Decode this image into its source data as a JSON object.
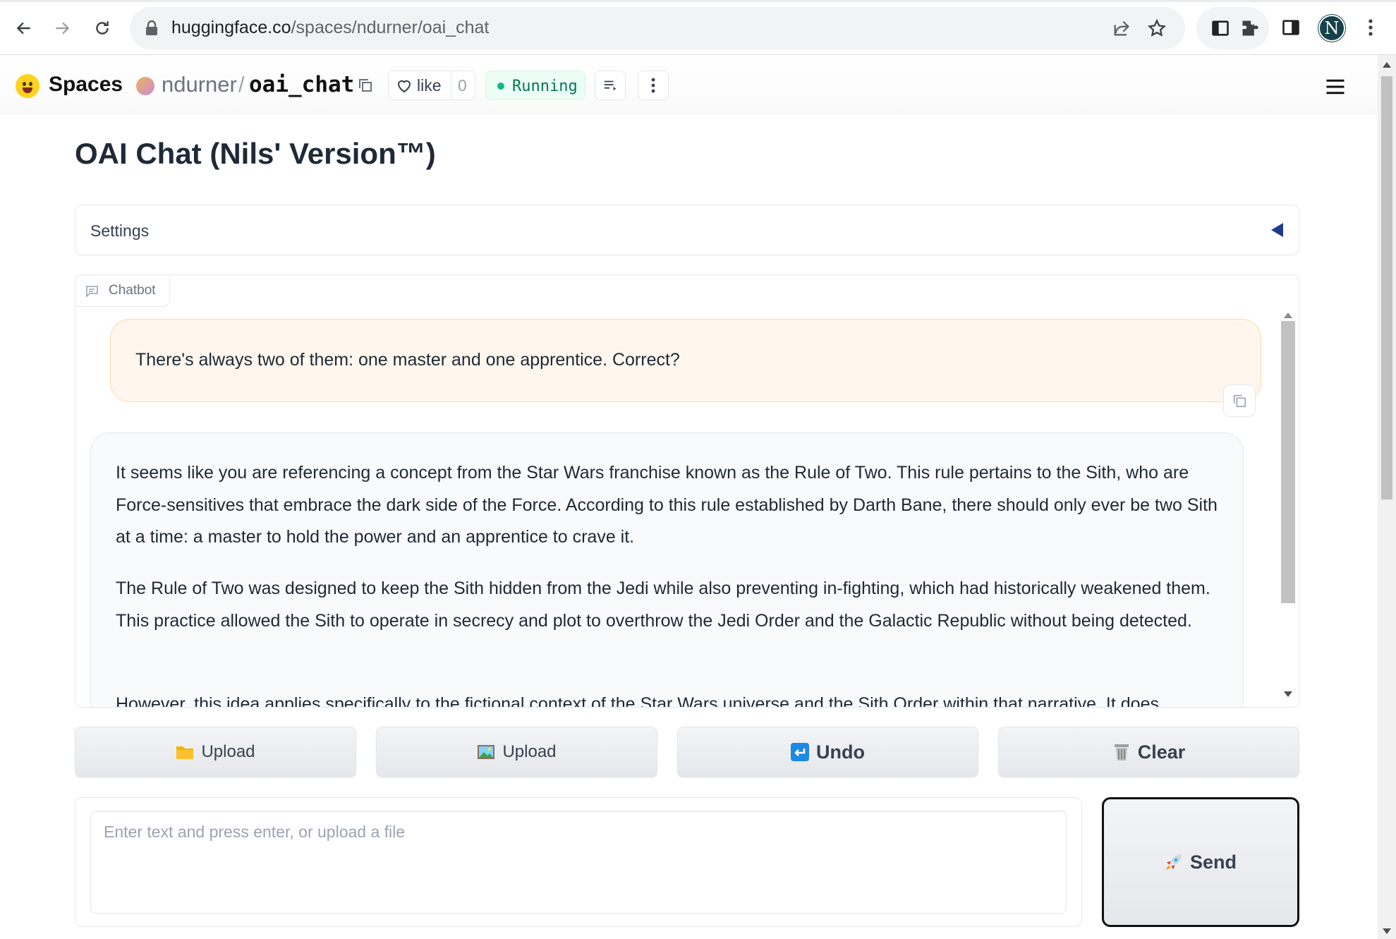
{
  "browser": {
    "url_host": "huggingface.co",
    "url_path": "/spaces/ndurner/oai_chat"
  },
  "header": {
    "spaces_label": "Spaces",
    "owner": "ndurner",
    "separator": "/",
    "repo": "oai_chat",
    "like_label": "like",
    "like_count": "0",
    "status": "Running",
    "status_color": "#10b981",
    "accent_color": "#ffd21e"
  },
  "app": {
    "title": "OAI Chat (Nils' Version™)",
    "settings_label": "Settings"
  },
  "chatbot": {
    "tab_label": "Chatbot",
    "user_message": "There's always two of them: one master and one apprentice. Correct?",
    "bot_paragraphs": [
      "It seems like you are referencing a concept from the Star Wars franchise known as the Rule of Two. This rule pertains to the Sith, who are Force-sensitives that embrace the dark side of the Force. According to this rule established by Darth Bane, there should only ever be two Sith at a time: a master to hold the power and an apprentice to crave it.",
      "The Rule of Two was designed to keep the Sith hidden from the Jedi while also preventing in-fighting, which had historically weakened them. This practice allowed the Sith to operate in secrecy and plot to overthrow the Jedi Order and the Galactic Republic without being detected.",
      "However, this idea applies specifically to the fictional context of the Star Wars universe and the Sith Order within that narrative. It does"
    ]
  },
  "actions": {
    "upload_file_label": "Upload",
    "upload_image_label": "Upload",
    "undo_label": "Undo",
    "clear_label": "Clear"
  },
  "input": {
    "placeholder": "Enter text and press enter, or upload a file",
    "value": ""
  },
  "send_label": "Send"
}
